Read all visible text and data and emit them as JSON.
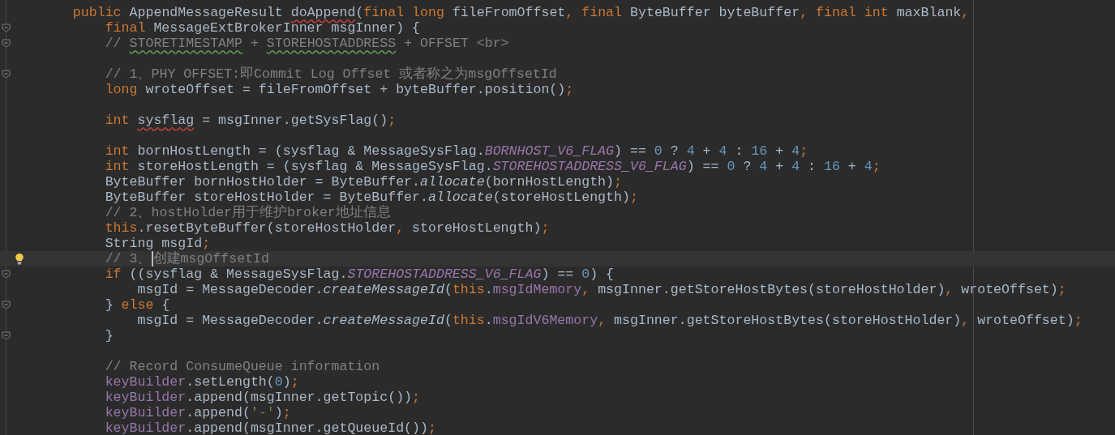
{
  "editor": {
    "lines": [
      {
        "current": false,
        "fold_marker": false,
        "intention_bulb": false,
        "tokens": [
          {
            "kind": "keyword",
            "text": "    public"
          },
          {
            "kind": "plain",
            "text": " AppendMessageResult "
          },
          {
            "kind": "plain",
            "text": "doAppend",
            "underlined": true
          },
          {
            "kind": "plain",
            "text": "("
          },
          {
            "kind": "keyword",
            "text": "final long"
          },
          {
            "kind": "plain",
            "text": " fileFromOffset"
          },
          {
            "kind": "keyword",
            "text": ", final"
          },
          {
            "kind": "plain",
            "text": " ByteBuffer byteBuffer"
          },
          {
            "kind": "keyword",
            "text": ", final int"
          },
          {
            "kind": "plain",
            "text": " maxBlank"
          },
          {
            "kind": "keyword",
            "text": ","
          }
        ]
      },
      {
        "current": false,
        "fold_marker": true,
        "intention_bulb": false,
        "tokens": [
          {
            "kind": "keyword",
            "text": "        final"
          },
          {
            "kind": "plain",
            "text": " MessageExtBrokerInner msgInner) {"
          }
        ]
      },
      {
        "current": false,
        "fold_marker": true,
        "intention_bulb": false,
        "tokens": [
          {
            "kind": "comment",
            "text": "        // "
          },
          {
            "kind": "comment",
            "text": "STORETIMESTAMP",
            "underlined": true
          },
          {
            "kind": "comment",
            "text": " + "
          },
          {
            "kind": "comment",
            "text": "STOREHOSTADDRESS",
            "underlined": true
          },
          {
            "kind": "comment",
            "text": " + OFFSET <br>"
          }
        ]
      },
      {
        "current": false,
        "fold_marker": false,
        "intention_bulb": false
      },
      {
        "current": false,
        "fold_marker": true,
        "intention_bulb": false,
        "tokens": [
          {
            "kind": "comment",
            "text": "        // 1、PHY OFFSET:即Commit Log Offset 或者称之为msgOffsetId"
          }
        ]
      },
      {
        "current": false,
        "fold_marker": false,
        "intention_bulb": false,
        "tokens": [
          {
            "kind": "keyword",
            "text": "        long"
          },
          {
            "kind": "plain",
            "text": " wroteOffset = fileFromOffset + byteBuffer.position()"
          },
          {
            "kind": "keyword",
            "text": ";"
          }
        ]
      },
      {
        "current": false,
        "fold_marker": false,
        "intention_bulb": false
      },
      {
        "current": false,
        "fold_marker": false,
        "intention_bulb": false,
        "tokens": [
          {
            "kind": "keyword",
            "text": "        int "
          },
          {
            "kind": "plain",
            "text": "sysflag",
            "underlined": true
          },
          {
            "kind": "plain",
            "text": " = msgInner.getSysFlag()"
          },
          {
            "kind": "keyword",
            "text": ";"
          }
        ]
      },
      {
        "current": false,
        "fold_marker": false,
        "intention_bulb": false
      },
      {
        "current": false,
        "fold_marker": false,
        "intention_bulb": false,
        "tokens": [
          {
            "kind": "keyword",
            "text": "        int"
          },
          {
            "kind": "plain",
            "text": " bornHostLength = (sysflag & MessageSysFlag."
          },
          {
            "kind": "constant",
            "text": "BORNHOST_V6_FLAG"
          },
          {
            "kind": "plain",
            "text": ") == "
          },
          {
            "kind": "number",
            "text": "0"
          },
          {
            "kind": "plain",
            "text": " ? "
          },
          {
            "kind": "number",
            "text": "4"
          },
          {
            "kind": "plain",
            "text": " + "
          },
          {
            "kind": "number",
            "text": "4"
          },
          {
            "kind": "plain",
            "text": " : "
          },
          {
            "kind": "number",
            "text": "16"
          },
          {
            "kind": "plain",
            "text": " + "
          },
          {
            "kind": "number",
            "text": "4"
          },
          {
            "kind": "keyword",
            "text": ";"
          }
        ]
      },
      {
        "current": false,
        "fold_marker": false,
        "intention_bulb": false,
        "tokens": [
          {
            "kind": "keyword",
            "text": "        int"
          },
          {
            "kind": "plain",
            "text": " storeHostLength = (sysflag & MessageSysFlag."
          },
          {
            "kind": "constant",
            "text": "STOREHOSTADDRESS_V6_FLAG"
          },
          {
            "kind": "plain",
            "text": ") == "
          },
          {
            "kind": "number",
            "text": "0"
          },
          {
            "kind": "plain",
            "text": " ? "
          },
          {
            "kind": "number",
            "text": "4"
          },
          {
            "kind": "plain",
            "text": " + "
          },
          {
            "kind": "number",
            "text": "4"
          },
          {
            "kind": "plain",
            "text": " : "
          },
          {
            "kind": "number",
            "text": "16"
          },
          {
            "kind": "plain",
            "text": " + "
          },
          {
            "kind": "number",
            "text": "4"
          },
          {
            "kind": "keyword",
            "text": ";"
          }
        ]
      },
      {
        "current": false,
        "fold_marker": false,
        "intention_bulb": false,
        "tokens": [
          {
            "kind": "plain",
            "text": "        ByteBuffer bornHostHolder = ByteBuffer."
          },
          {
            "kind": "static_call",
            "text": "allocate"
          },
          {
            "kind": "plain",
            "text": "(bornHostLength)"
          },
          {
            "kind": "keyword",
            "text": ";"
          }
        ]
      },
      {
        "current": false,
        "fold_marker": false,
        "intention_bulb": false,
        "tokens": [
          {
            "kind": "plain",
            "text": "        ByteBuffer storeHostHolder = ByteBuffer."
          },
          {
            "kind": "static_call",
            "text": "allocate"
          },
          {
            "kind": "plain",
            "text": "(storeHostLength)"
          },
          {
            "kind": "keyword",
            "text": ";"
          }
        ]
      },
      {
        "current": false,
        "fold_marker": false,
        "intention_bulb": false,
        "tokens": [
          {
            "kind": "comment",
            "text": "        // 2、hostHolder用于维护broker地址信息"
          }
        ]
      },
      {
        "current": false,
        "fold_marker": false,
        "intention_bulb": false,
        "tokens": [
          {
            "kind": "keyword",
            "text": "        this"
          },
          {
            "kind": "plain",
            "text": ".resetByteBuffer(storeHostHolder"
          },
          {
            "kind": "keyword",
            "text": ","
          },
          {
            "kind": "plain",
            "text": " storeHostLength)"
          },
          {
            "kind": "keyword",
            "text": ";"
          }
        ]
      },
      {
        "current": false,
        "fold_marker": false,
        "intention_bulb": false,
        "tokens": [
          {
            "kind": "plain",
            "text": "        String msgId"
          },
          {
            "kind": "keyword",
            "text": ";"
          }
        ]
      },
      {
        "current": true,
        "fold_marker": false,
        "intention_bulb": true,
        "tokens": [
          {
            "kind": "comment",
            "text": "        // 3、"
          },
          {
            "kind": "comment",
            "text": "创建msgOffsetId",
            "caret": true
          }
        ]
      },
      {
        "current": false,
        "fold_marker": true,
        "intention_bulb": false,
        "tokens": [
          {
            "kind": "keyword",
            "text": "        if"
          },
          {
            "kind": "plain",
            "text": " ((sysflag & MessageSysFlag."
          },
          {
            "kind": "constant",
            "text": "STOREHOSTADDRESS_V6_FLAG"
          },
          {
            "kind": "plain",
            "text": ") == "
          },
          {
            "kind": "number",
            "text": "0"
          },
          {
            "kind": "plain",
            "text": ") {"
          }
        ]
      },
      {
        "current": false,
        "fold_marker": false,
        "intention_bulb": false,
        "tokens": [
          {
            "kind": "plain",
            "text": "            msgId = MessageDecoder."
          },
          {
            "kind": "static_call",
            "text": "createMessageId"
          },
          {
            "kind": "plain",
            "text": "("
          },
          {
            "kind": "keyword",
            "text": "this"
          },
          {
            "kind": "plain",
            "text": "."
          },
          {
            "kind": "field",
            "text": "msgIdMemory"
          },
          {
            "kind": "keyword",
            "text": ","
          },
          {
            "kind": "plain",
            "text": " msgInner.getStoreHostBytes(storeHostHolder)"
          },
          {
            "kind": "keyword",
            "text": ","
          },
          {
            "kind": "plain",
            "text": " wroteOffset)"
          },
          {
            "kind": "keyword",
            "text": ";"
          }
        ]
      },
      {
        "current": false,
        "fold_marker": true,
        "intention_bulb": false,
        "tokens": [
          {
            "kind": "plain",
            "text": "        } "
          },
          {
            "kind": "keyword",
            "text": "else"
          },
          {
            "kind": "plain",
            "text": " {"
          }
        ]
      },
      {
        "current": false,
        "fold_marker": false,
        "intention_bulb": false,
        "tokens": [
          {
            "kind": "plain",
            "text": "            msgId = MessageDecoder."
          },
          {
            "kind": "static_call",
            "text": "createMessageId"
          },
          {
            "kind": "plain",
            "text": "("
          },
          {
            "kind": "keyword",
            "text": "this"
          },
          {
            "kind": "plain",
            "text": "."
          },
          {
            "kind": "field",
            "text": "msgIdV6Memory"
          },
          {
            "kind": "keyword",
            "text": ","
          },
          {
            "kind": "plain",
            "text": " msgInner.getStoreHostBytes(storeHostHolder)"
          },
          {
            "kind": "keyword",
            "text": ","
          },
          {
            "kind": "plain",
            "text": " wroteOffset)"
          },
          {
            "kind": "keyword",
            "text": ";"
          }
        ]
      },
      {
        "current": false,
        "fold_marker": true,
        "intention_bulb": false,
        "tokens": [
          {
            "kind": "plain",
            "text": "        }"
          }
        ]
      },
      {
        "current": false,
        "fold_marker": false,
        "intention_bulb": false
      },
      {
        "current": false,
        "fold_marker": false,
        "intention_bulb": false,
        "tokens": [
          {
            "kind": "comment",
            "text": "        // Record ConsumeQueue information"
          }
        ]
      },
      {
        "current": false,
        "fold_marker": false,
        "intention_bulb": false,
        "tokens": [
          {
            "kind": "field",
            "text": "        keyBuilder"
          },
          {
            "kind": "plain",
            "text": ".setLength("
          },
          {
            "kind": "number",
            "text": "0"
          },
          {
            "kind": "plain",
            "text": ")"
          },
          {
            "kind": "keyword",
            "text": ";"
          }
        ]
      },
      {
        "current": false,
        "fold_marker": false,
        "intention_bulb": false,
        "tokens": [
          {
            "kind": "field",
            "text": "        keyBuilder"
          },
          {
            "kind": "plain",
            "text": ".append(msgInner.getTopic())"
          },
          {
            "kind": "keyword",
            "text": ";"
          }
        ]
      },
      {
        "current": false,
        "fold_marker": false,
        "intention_bulb": false,
        "tokens": [
          {
            "kind": "field",
            "text": "        keyBuilder"
          },
          {
            "kind": "plain",
            "text": ".append("
          },
          {
            "kind": "string",
            "text": "'-'"
          },
          {
            "kind": "plain",
            "text": ")"
          },
          {
            "kind": "keyword",
            "text": ";"
          }
        ]
      },
      {
        "current": false,
        "fold_marker": false,
        "intention_bulb": false,
        "tokens": [
          {
            "kind": "field",
            "text": "        keyBuilder"
          },
          {
            "kind": "plain",
            "text": ".append(msgInner.getQueueId())"
          },
          {
            "kind": "keyword",
            "text": ";"
          }
        ]
      }
    ]
  }
}
